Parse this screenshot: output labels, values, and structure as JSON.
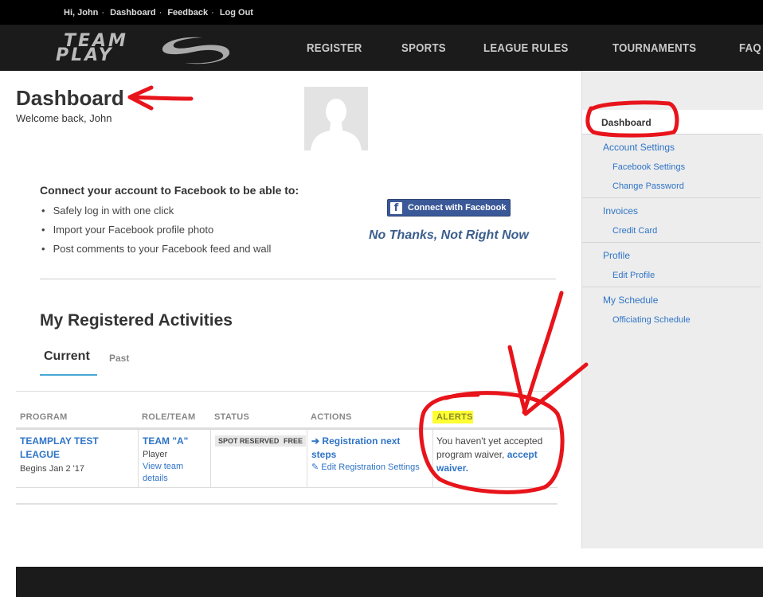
{
  "topbar": {
    "greeting": "Hi, John",
    "links": [
      "Dashboard",
      "Feedback",
      "Log Out"
    ]
  },
  "brand": {
    "word1": "TEAM",
    "word2": "PLAY"
  },
  "nav": {
    "items": [
      "REGISTER",
      "SPORTS",
      "LEAGUE RULES",
      "TOURNAMENTS",
      "FAQ"
    ]
  },
  "header": {
    "title": "Dashboard",
    "welcome": "Welcome back, John"
  },
  "facebook": {
    "title": "Connect your account to Facebook to be able to:",
    "benefits": [
      "Safely log in with one click",
      "Import your Facebook profile photo",
      "Post comments to your Facebook feed and wall"
    ],
    "connect_label": "Connect with Facebook",
    "decline_label": "No Thanks, Not Right Now"
  },
  "activities": {
    "title": "My Registered Activities",
    "tabs": [
      "Current",
      "Past"
    ],
    "columns": [
      "PROGRAM",
      "ROLE/TEAM",
      "STATUS",
      "ACTIONS",
      "ALERTS"
    ],
    "row": {
      "program_line1": "TEAMPLAY TEST",
      "program_line2": "LEAGUE",
      "program_begins": "Begins Jan 2 '17",
      "team_name": "TEAM \"A\"",
      "role": "Player",
      "view_team_line1": "View team",
      "view_team_line2": "details",
      "status_badges": [
        "SPOT RESERVED",
        "FREE"
      ],
      "action_next_line1": "Registration next",
      "action_next_line2": "steps",
      "action_edit": "Edit Registration Settings",
      "alert_line1": "You haven't yet accepted",
      "alert_line2": "program waiver,",
      "alert_link1": "accept",
      "alert_link2": "waiver."
    }
  },
  "sidebar": {
    "active": "Dashboard",
    "items": [
      {
        "label": "Account Settings"
      },
      {
        "label": "Facebook Settings"
      },
      {
        "label": "Change Password"
      },
      {
        "label": "Invoices"
      },
      {
        "label": "Credit Card"
      },
      {
        "label": "Profile"
      },
      {
        "label": "Edit Profile"
      },
      {
        "label": "My Schedule"
      },
      {
        "label": "Officiating Schedule"
      }
    ]
  },
  "colors": {
    "link": "#2f74c6",
    "facebook": "#3b5998",
    "annotation": "#e8141b",
    "highlight": "#ffff33"
  }
}
